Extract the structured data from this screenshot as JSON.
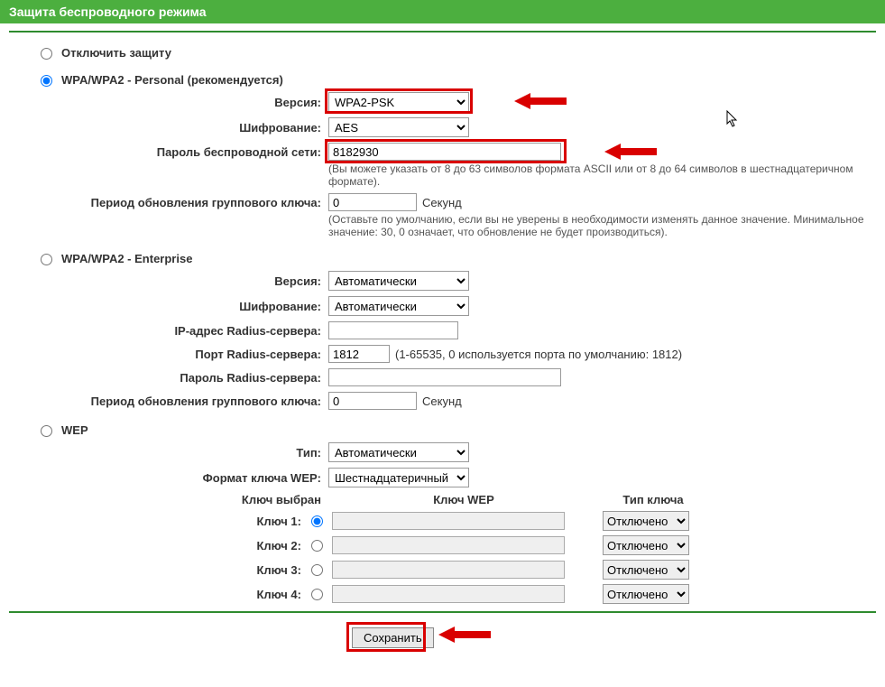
{
  "header": {
    "title": "Защита беспроводного режима"
  },
  "security_modes": {
    "disable_label": "Отключить защиту",
    "wpa_personal_label": "WPA/WPA2 - Personal (рекомендуется)",
    "wpa_enterprise_label": "WPA/WPA2 - Enterprise",
    "wep_label": "WEP",
    "selected": "wpa_personal"
  },
  "wpa_personal": {
    "version_label": "Версия:",
    "version_value": "WPA2-PSK",
    "encryption_label": "Шифрование:",
    "encryption_value": "AES",
    "password_label": "Пароль беспроводной сети:",
    "password_value": "8182930",
    "password_hint": "(Вы можете указать от 8 до 63 символов формата ASCII или от 8 до 64 символов в шестнадцатеричном формате).",
    "group_key_label": "Период обновления группового ключа:",
    "group_key_value": "0",
    "group_key_unit": "Секунд",
    "group_key_hint": "(Оставьте по умолчанию, если вы не уверены в необходимости изменять данное значение. Минимальное значение: 30, 0 означает, что обновление не будет производиться)."
  },
  "wpa_enterprise": {
    "version_label": "Версия:",
    "version_value": "Автоматически",
    "encryption_label": "Шифрование:",
    "encryption_value": "Автоматически",
    "radius_ip_label": "IP-адрес Radius-сервера:",
    "radius_ip_value": "",
    "radius_port_label": "Порт Radius-сервера:",
    "radius_port_value": "1812",
    "radius_port_hint": "(1-65535, 0 используется порта по умолчанию: 1812)",
    "radius_pw_label": "Пароль Radius-сервера:",
    "radius_pw_value": "",
    "group_key_label": "Период обновления группового ключа:",
    "group_key_value": "0",
    "group_key_unit": "Секунд"
  },
  "wep": {
    "type_label": "Тип:",
    "type_value": "Автоматически",
    "format_label": "Формат ключа WEP:",
    "format_value": "Шестнадцатеричный",
    "col_selected": "Ключ выбран",
    "col_key": "Ключ WEP",
    "col_type": "Тип ключа",
    "keys": [
      {
        "label": "Ключ 1:",
        "selected": true,
        "value": "",
        "type": "Отключено"
      },
      {
        "label": "Ключ 2:",
        "selected": false,
        "value": "",
        "type": "Отключено"
      },
      {
        "label": "Ключ 3:",
        "selected": false,
        "value": "",
        "type": "Отключено"
      },
      {
        "label": "Ключ 4:",
        "selected": false,
        "value": "",
        "type": "Отключено"
      }
    ]
  },
  "actions": {
    "save_label": "Сохранить"
  }
}
